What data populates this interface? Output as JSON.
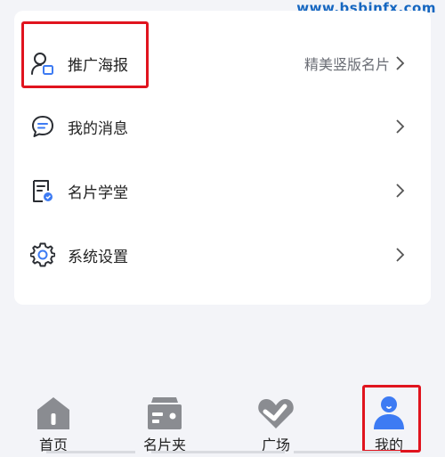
{
  "watermark": "www.bsbinfx.com",
  "menu": {
    "items": [
      {
        "label": "推广海报",
        "hint": "精美竖版名片",
        "icon": "user-poster-icon"
      },
      {
        "label": "我的消息",
        "hint": "",
        "icon": "message-bubble-icon"
      },
      {
        "label": "名片学堂",
        "hint": "",
        "icon": "document-badge-icon"
      },
      {
        "label": "系统设置",
        "hint": "",
        "icon": "gear-icon"
      }
    ]
  },
  "tabbar": {
    "tabs": [
      {
        "label": "首页",
        "icon": "home-icon",
        "active": false
      },
      {
        "label": "名片夹",
        "icon": "card-folder-icon",
        "active": false
      },
      {
        "label": "广场",
        "icon": "square-heart-icon",
        "active": false
      },
      {
        "label": "我的",
        "icon": "profile-icon",
        "active": true
      }
    ]
  },
  "colors": {
    "accent": "#3d7bf3",
    "highlight": "#e0141e",
    "inactive_icon": "#8a8c91",
    "background": "#f3f4f8"
  }
}
